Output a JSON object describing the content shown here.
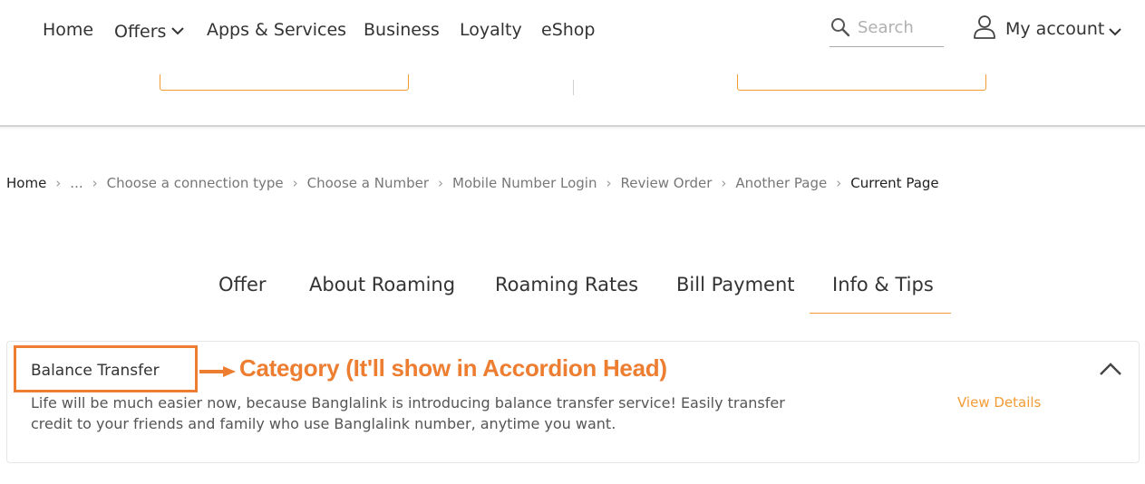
{
  "nav": {
    "items": [
      {
        "label": "Home"
      },
      {
        "label": "Offers"
      },
      {
        "label": "Apps & Services"
      },
      {
        "label": "Business"
      },
      {
        "label": "Loyalty"
      },
      {
        "label": "eShop"
      }
    ],
    "search_placeholder": "Search",
    "account_label": "My account"
  },
  "breadcrumb": {
    "items": [
      "Home",
      "...",
      "Choose a connection type",
      "Choose a Number",
      "Mobile Number Login",
      "Review Order",
      "Another Page"
    ],
    "current": "Current Page"
  },
  "tabs": [
    "Offer",
    "About Roaming",
    "Roaming Rates",
    "Bill Payment",
    "Info & Tips"
  ],
  "active_tab": "Info & Tips",
  "accordion": {
    "title": "Balance Transfer",
    "annotation": "Category (It'll show in Accordion Head)",
    "description": "Life will be much easier now, because Banglalink is introducing balance transfer service! Easily transfer credit to your friends and family who use Banglalink number, anytime you want.",
    "link_label": "View Details",
    "expanded": true
  },
  "colors": {
    "accent": "#f39c35",
    "annotation": "#ed7d31",
    "text": "#333333"
  }
}
